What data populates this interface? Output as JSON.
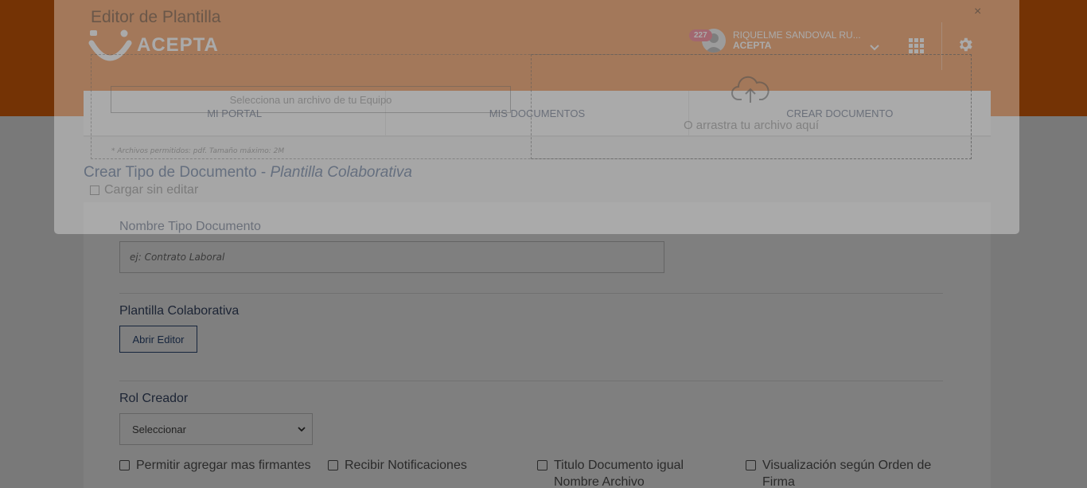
{
  "header": {
    "logo_text": "ACEPTA",
    "notification_count": "227",
    "user_name": "RIQUELME SANDOVAL RU...",
    "user_org": "ACEPTA",
    "brand_color": "#e8660b"
  },
  "nav": {
    "items": [
      {
        "label": "MI PORTAL"
      },
      {
        "label": "MIS DOCUMENTOS"
      },
      {
        "label": "CREAR DOCUMENTO"
      }
    ]
  },
  "page": {
    "title": "Crear Tipo de Documento - ",
    "title_emphasis": "Plantilla Colaborativa"
  },
  "form": {
    "name_label": "Nombre Tipo Documento",
    "name_placeholder": "ej: Contrato Laboral",
    "template_label": "Plantilla Colaborativa",
    "open_editor_label": "Abrir Editor",
    "role_label": "Rol Creador",
    "role_selected": "Seleccionar",
    "checkboxes": [
      {
        "label": "Permitir agregar mas firmantes",
        "checked": false
      },
      {
        "label": "Recibir Notificaciones",
        "checked": false
      },
      {
        "label": "Titulo Documento igual Nombre Archivo",
        "checked": false
      },
      {
        "label": "Visualización según Orden de Firma",
        "checked": false
      }
    ]
  },
  "modal": {
    "title": "Editor de Plantilla",
    "close_label": "×",
    "file_select_label": "Selecciona un archivo de tu Equipo",
    "drop_label": "O arrastra tu archivo aquí",
    "hint": "* Archivos permitidos: pdf. Tamaño máximo: 2M",
    "no_edit_label": "Cargar sin editar"
  }
}
